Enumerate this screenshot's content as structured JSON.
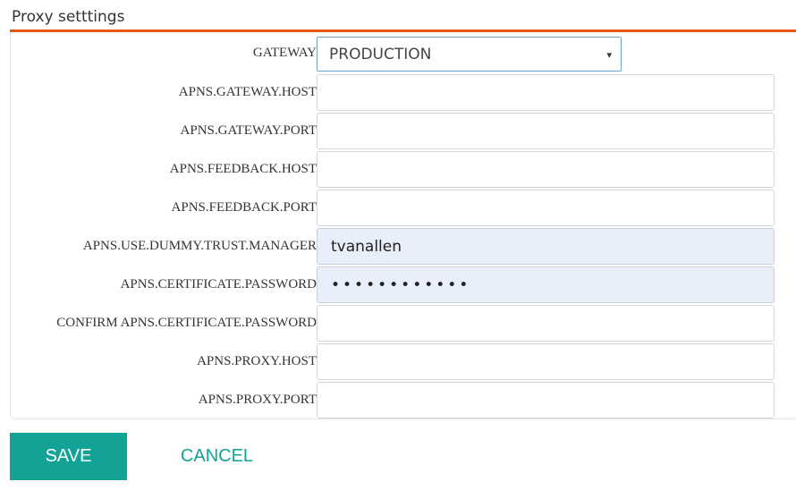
{
  "section": {
    "title": "Proxy setttings"
  },
  "gateway": {
    "label": "GATEWAY",
    "selected": "PRODUCTION",
    "chevron": "▾"
  },
  "fields": [
    {
      "label": "APNS.GATEWAY.HOST",
      "value": ""
    },
    {
      "label": "APNS.GATEWAY.PORT",
      "value": ""
    },
    {
      "label": "APNS.FEEDBACK.HOST",
      "value": ""
    },
    {
      "label": "APNS.FEEDBACK.PORT",
      "value": ""
    },
    {
      "label": "APNS.USE.DUMMY.TRUST.MANAGER",
      "value": "tvanallen"
    },
    {
      "label": "APNS.CERTIFICATE.PASSWORD",
      "value": "••••••••••••"
    },
    {
      "label": "CONFIRM APNS.CERTIFICATE.PASSWORD",
      "value": ""
    },
    {
      "label": "APNS.PROXY.HOST",
      "value": ""
    },
    {
      "label": "APNS.PROXY.PORT",
      "value": ""
    }
  ],
  "actions": {
    "save_label": "SAVE",
    "cancel_label": "CANCEL"
  },
  "colors": {
    "accent_rule": "#e8541c",
    "primary": "#13a396",
    "autofill_bg": "#e8eefa"
  }
}
